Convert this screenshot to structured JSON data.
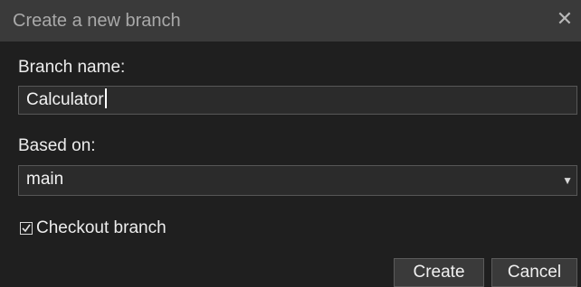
{
  "dialog": {
    "title": "Create a new branch",
    "close_icon": "close-icon",
    "branch_name_label": "Branch name:",
    "branch_name_value": "Calculator",
    "based_on_label": "Based on:",
    "based_on_value": "main",
    "checkout_label": "Checkout branch",
    "checkout_checked": true,
    "create_label": "Create",
    "cancel_label": "Cancel"
  },
  "colors": {
    "background": "#1f1f1f",
    "titlebar": "#3a3a3a",
    "input_bg": "#2b2b2b",
    "border": "#575757",
    "text": "#ededed"
  }
}
